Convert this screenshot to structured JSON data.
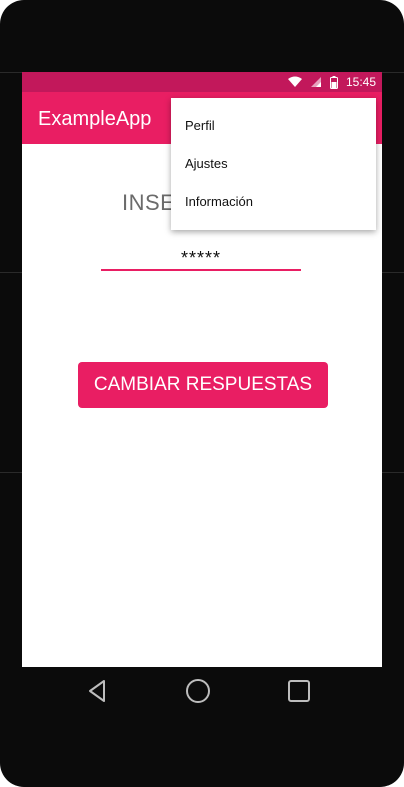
{
  "status_bar": {
    "time": "15:45",
    "wifi_icon": "wifi-icon",
    "signal_icon": "signal-icon",
    "battery_icon": "battery-icon"
  },
  "app_bar": {
    "title": "ExampleApp",
    "accent_color": "#e91e63"
  },
  "overflow_menu": {
    "items": [
      {
        "label": "Perfil"
      },
      {
        "label": "Ajustes"
      },
      {
        "label": "Información"
      }
    ]
  },
  "content": {
    "prompt_label": "INSE",
    "password_value": "*****",
    "change_answers_button": "CAMBIAR RESPUESTAS"
  },
  "nav_bar": {
    "back_icon": "back-icon",
    "home_icon": "home-icon",
    "recents_icon": "recents-icon"
  },
  "colors": {
    "status_bar": "#c2185b",
    "app_bar": "#e91e63",
    "button": "#e91e63"
  }
}
